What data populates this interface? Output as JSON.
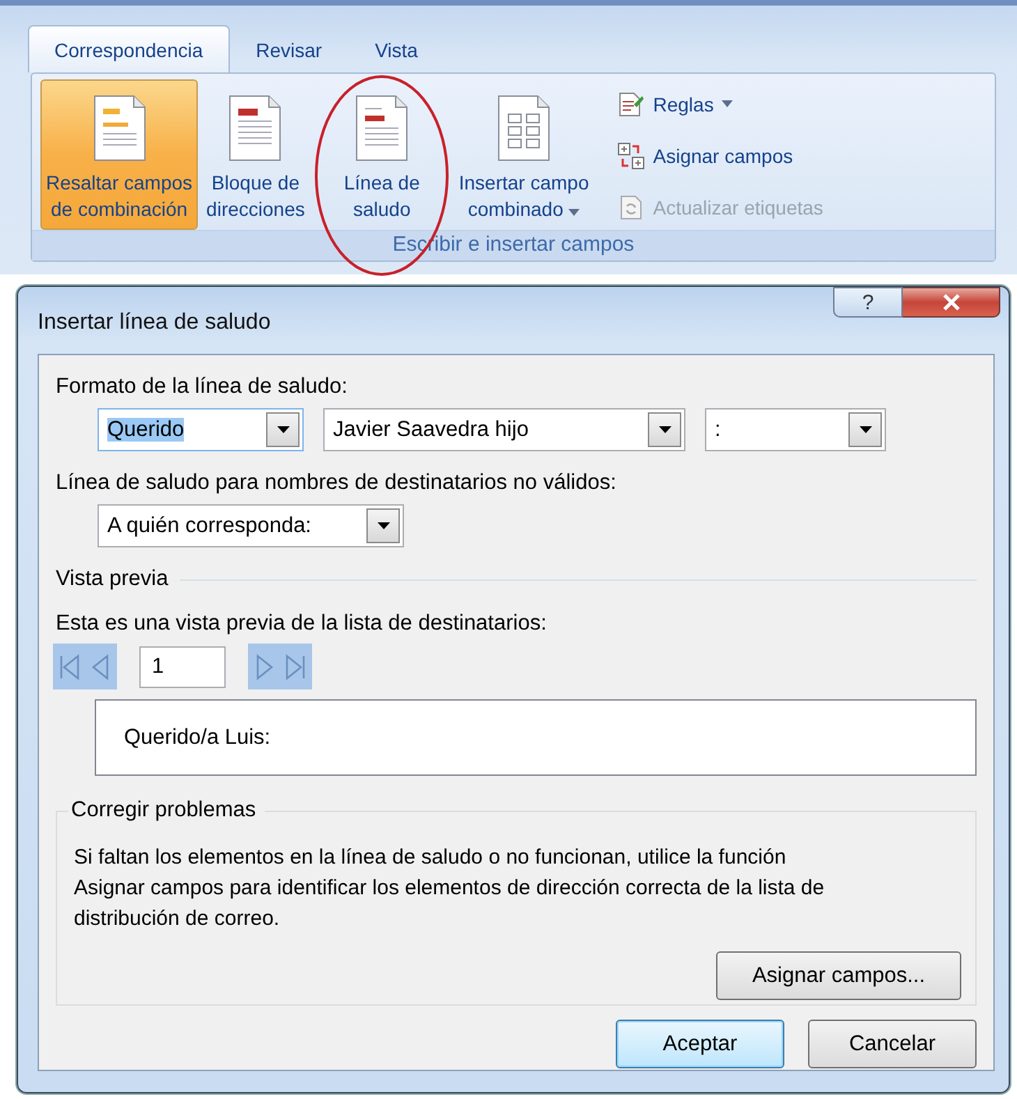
{
  "ribbon": {
    "tabs": [
      {
        "label": "Correspondencia",
        "selected": true
      },
      {
        "label": "Revisar",
        "selected": false
      },
      {
        "label": "Vista",
        "selected": false
      }
    ],
    "group": {
      "label": "Escribir e insertar campos",
      "large_buttons": [
        {
          "kind": "highlight",
          "label": "Resaltar campos\nde combinación",
          "selected": true,
          "has_menu": false,
          "circled": false
        },
        {
          "kind": "address",
          "label": "Bloque de\ndirecciones",
          "selected": false,
          "has_menu": false,
          "circled": false
        },
        {
          "kind": "greeting",
          "label": "Línea de\nsaludo",
          "selected": false,
          "has_menu": false,
          "circled": true
        },
        {
          "kind": "field",
          "label": "Insertar campo\ncombinado",
          "selected": false,
          "has_menu": true,
          "circled": false
        }
      ],
      "small_buttons": [
        {
          "kind": "rules",
          "label": "Reglas",
          "has_menu": true,
          "disabled": false
        },
        {
          "kind": "match",
          "label": "Asignar campos",
          "has_menu": false,
          "disabled": false
        },
        {
          "kind": "update",
          "label": "Actualizar etiquetas",
          "has_menu": false,
          "disabled": true
        }
      ]
    }
  },
  "dialog": {
    "title": "Insertar línea de saludo",
    "help_button": "?",
    "format": {
      "label": "Formato de la línea de saludo:",
      "dropdowns": [
        {
          "value": "Querido",
          "highlighted": true
        },
        {
          "value": "Javier Saavedra hijo",
          "highlighted": false
        },
        {
          "value": ":",
          "highlighted": false
        }
      ]
    },
    "invalid": {
      "label": "Línea de saludo para nombres de destinatarios no válidos:",
      "dropdown": {
        "value": "A quién corresponda:",
        "highlighted": false
      }
    },
    "preview": {
      "heading": "Vista previa",
      "label": "Esta es una vista previa de la lista de destinatarios:",
      "record": "1",
      "text": "Querido/a Luis:"
    },
    "fix": {
      "heading": "Corregir problemas",
      "description": "Si faltan los elementos en la línea de saludo o no funcionan, utilice la función Asignar campos para identificar los elementos de dirección correcta de la lista de distribución de correo.",
      "button": "Asignar campos..."
    },
    "buttons": [
      {
        "label": "Aceptar",
        "default": true
      },
      {
        "label": "Cancelar",
        "default": false
      }
    ]
  }
}
